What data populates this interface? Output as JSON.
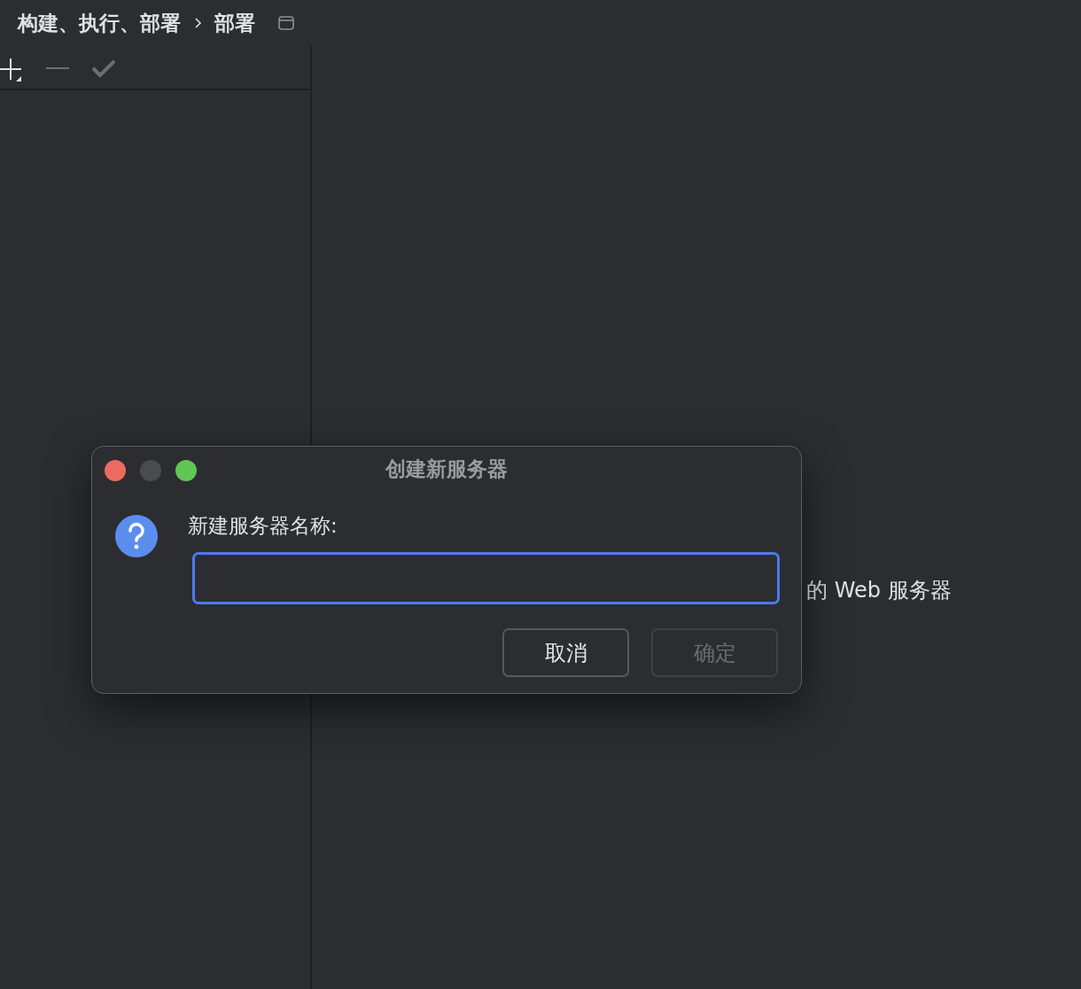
{
  "breadcrumb": {
    "items": [
      "构建、执行、部署",
      "部署"
    ]
  },
  "toolbar": {
    "buttons": [
      {
        "kind": "add",
        "disabled": false
      },
      {
        "kind": "remove",
        "disabled": true
      },
      {
        "kind": "apply",
        "disabled": true
      }
    ]
  },
  "details": {
    "hint": "的 Web 服务器"
  },
  "dialog": {
    "title": "创建新服务器",
    "prompt": "新建服务器名称:",
    "field": {
      "focused": true
    },
    "buttons": [
      {
        "label": "取消",
        "disabled": false
      },
      {
        "label": "确定",
        "disabled": true
      }
    ]
  }
}
